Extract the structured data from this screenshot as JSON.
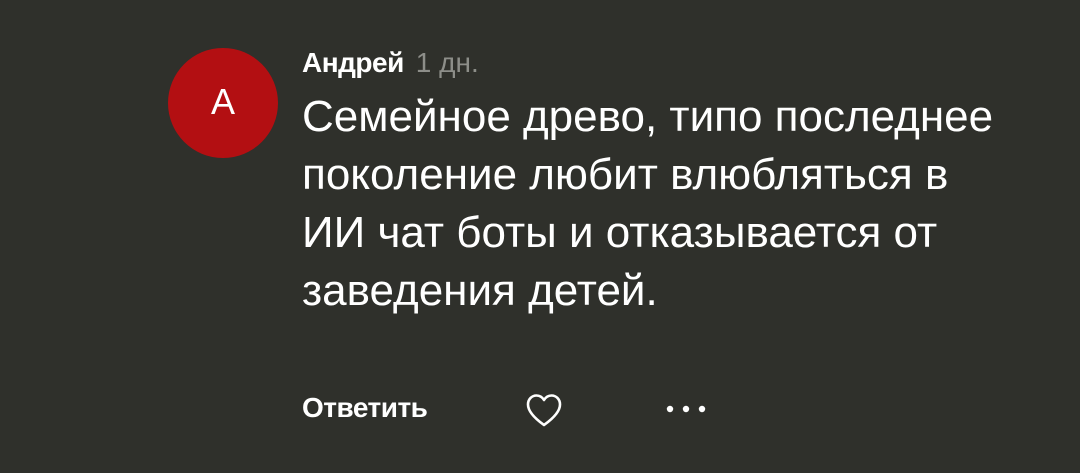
{
  "comment": {
    "avatar_letter": "А",
    "avatar_color": "#b30f12",
    "author": "Андрей",
    "time": "1 дн.",
    "text": "Семейное древо, типо последнее поколение любит влюбляться в ИИ чат боты и отказывается от заведения детей."
  },
  "actions": {
    "reply_label": "Ответить",
    "like_icon": "heart-outline-icon",
    "more_icon": "more-horizontal-icon"
  }
}
